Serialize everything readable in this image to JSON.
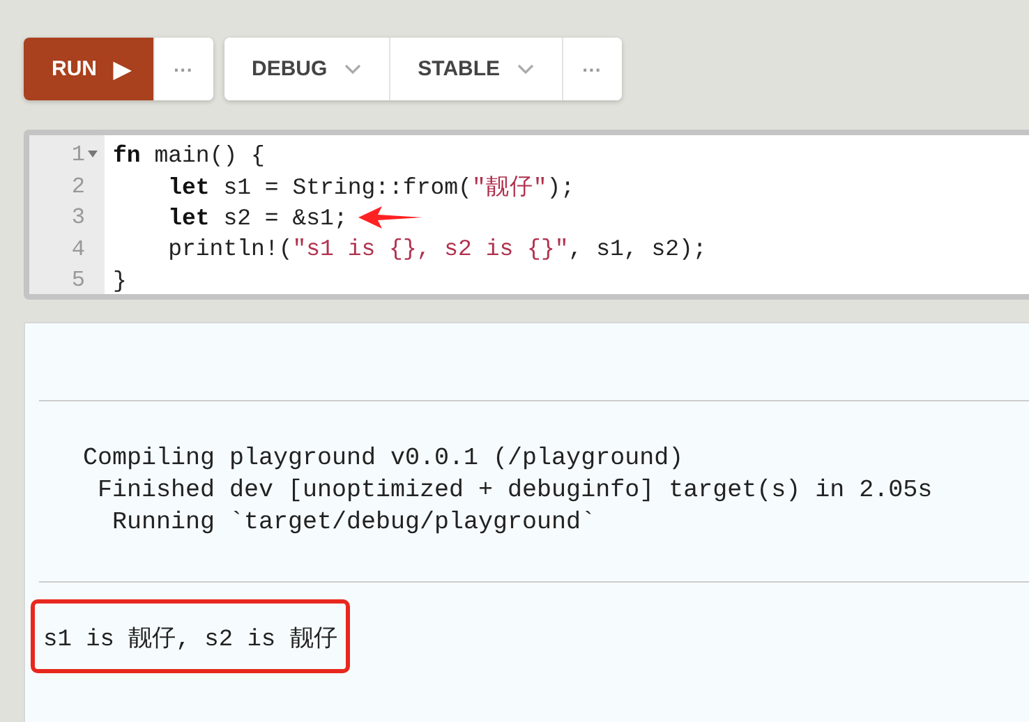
{
  "toolbar": {
    "run": {
      "label": "RUN",
      "icon": "▶"
    },
    "run_more": "···",
    "groups": [
      {
        "kind": "dropdown",
        "label": "DEBUG"
      },
      {
        "kind": "dropdown",
        "label": "STABLE"
      },
      {
        "kind": "more",
        "label": "···"
      }
    ]
  },
  "editor": {
    "lines": [
      {
        "number": "1",
        "foldable": true,
        "annotated": false,
        "tokens": [
          {
            "kind": "keyword",
            "text": "fn"
          },
          {
            "kind": "plain",
            "text": " main() {"
          }
        ]
      },
      {
        "number": "2",
        "foldable": false,
        "annotated": false,
        "tokens": [
          {
            "kind": "keyword",
            "text": "    let"
          },
          {
            "kind": "plain",
            "text": " s1 = String::from("
          },
          {
            "kind": "string",
            "text": "\"靓仔\""
          },
          {
            "kind": "plain",
            "text": ");"
          }
        ]
      },
      {
        "number": "3",
        "foldable": false,
        "annotated": true,
        "tokens": [
          {
            "kind": "keyword",
            "text": "    let"
          },
          {
            "kind": "plain",
            "text": " s2 = &s1;"
          }
        ]
      },
      {
        "number": "4",
        "foldable": false,
        "annotated": false,
        "tokens": [
          {
            "kind": "plain",
            "text": "    println!("
          },
          {
            "kind": "string",
            "text": "\"s1 is {}, s2 is {}\""
          },
          {
            "kind": "plain",
            "text": ", s1, s2);"
          }
        ]
      },
      {
        "number": "5",
        "foldable": false,
        "annotated": false,
        "tokens": [
          {
            "kind": "plain",
            "text": "}"
          }
        ]
      }
    ]
  },
  "output": {
    "log": [
      "   Compiling playground v0.0.1 (/playground)",
      "    Finished dev [unoptimized + debuginfo] target(s) in 2.05s",
      "     Running `target/debug/playground`"
    ],
    "result": {
      "text": "s1 is 靓仔, s2 is 靓仔",
      "highlighted": true
    }
  }
}
